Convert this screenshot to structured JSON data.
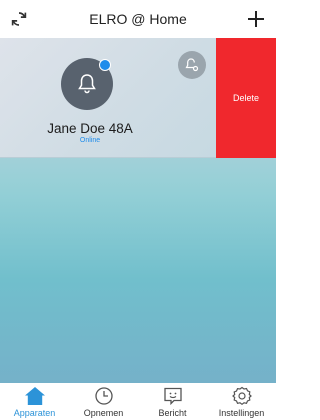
{
  "header": {
    "title": "ELRO @ Home",
    "refresh_icon": "refresh-icon",
    "add_icon": "plus-icon"
  },
  "device": {
    "name": "Jane Doe 48A",
    "status": "Online",
    "icon": "bell-icon",
    "secondary_icon": "bell-settings-icon",
    "status_color": "#1f8ceb"
  },
  "swipe_action": {
    "delete_label": "Delete",
    "color": "#f0282d"
  },
  "tabs": [
    {
      "label": "Apparaten",
      "icon": "home-icon",
      "active": true
    },
    {
      "label": "Opnemen",
      "icon": "clock-icon",
      "active": false
    },
    {
      "label": "Bericht",
      "icon": "message-icon",
      "active": false
    },
    {
      "label": "Instellingen",
      "icon": "gear-icon",
      "active": false
    }
  ],
  "colors": {
    "accent": "#2c93d8"
  }
}
